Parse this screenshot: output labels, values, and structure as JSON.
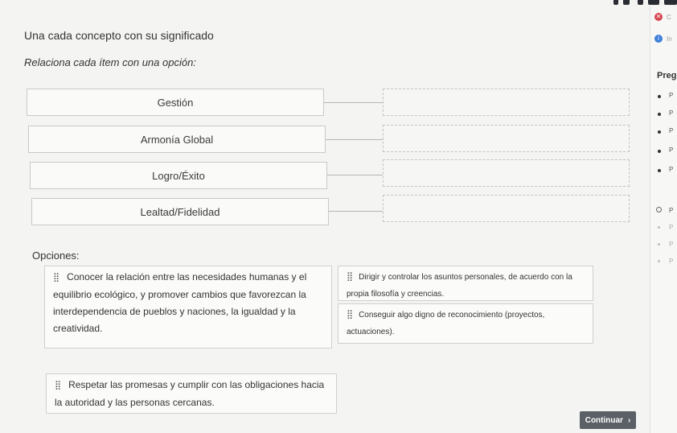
{
  "title": "Una cada concepto con su significado",
  "subtitle": "Relaciona cada ítem con una opción:",
  "concepts": [
    "Gestión",
    "Armonía Global",
    "Logro/Éxito",
    "Lealtad/Fidelidad"
  ],
  "options_heading": "Opciones:",
  "options": [
    "Conocer la relación entre las necesidades humanas y el equilibrio ecológico, y promover cambios que favorezcan la interdependencia de pueblos y naciones, la igualdad y la creatividad.",
    "Dirigir y controlar los asuntos personales, de acuerdo con la propia filosofía y creencias.",
    "Conseguir algo digno de reconocimiento (proyectos, actuaciones).",
    "Respetar las promesas y cumplir con las obligaciones hacia la autoridad y las personas cercanas."
  ],
  "continue_label": "Continuar",
  "continue_icon": "chevron-right-icon",
  "side_panel": {
    "close_icon": "close-icon",
    "close_text": "C",
    "info_icon": "info-icon",
    "info_text": "In",
    "header": "Pregu",
    "items": [
      "P",
      "P",
      "P",
      "P",
      "P",
      "P",
      "P",
      "P",
      "P"
    ]
  },
  "colors": {
    "close": "#d64550",
    "info": "#3d7fd9",
    "button": "#5a6066"
  }
}
